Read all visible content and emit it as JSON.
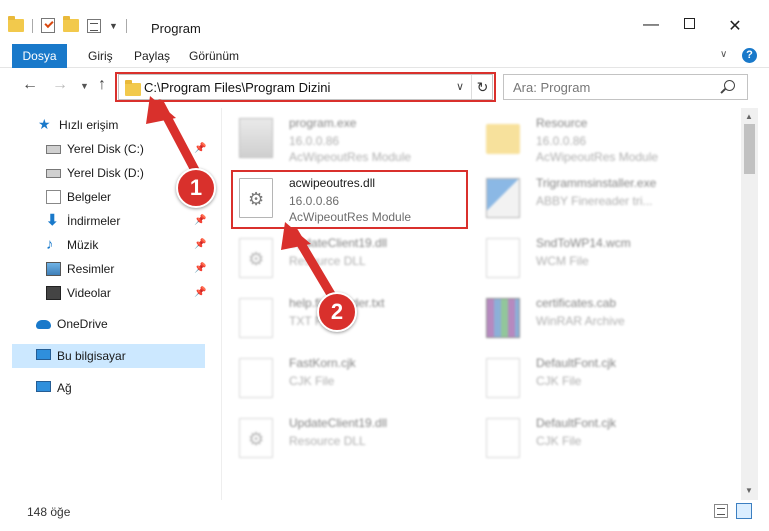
{
  "window": {
    "title": "Program"
  },
  "ribbon": {
    "tabs": [
      "Dosya",
      "Giriş",
      "Paylaş",
      "Görünüm"
    ],
    "help_icon": "help-icon"
  },
  "nav": {
    "address": "C:\\Program Files\\Program Dizini",
    "search_placeholder": "Ara: Program"
  },
  "sidebar": {
    "items": [
      {
        "label": "Hızlı erişim",
        "icon": "star-icon"
      },
      {
        "label": "Yerel Disk (C:)",
        "icon": "disk-icon",
        "pinned": true
      },
      {
        "label": "Yerel Disk (D:)",
        "icon": "disk-icon"
      },
      {
        "label": "Belgeler",
        "icon": "documents-icon",
        "pinned": true
      },
      {
        "label": "İndirmeler",
        "icon": "download-icon",
        "pinned": true
      },
      {
        "label": "Müzik",
        "icon": "music-icon",
        "pinned": true
      },
      {
        "label": "Resimler",
        "icon": "pictures-icon",
        "pinned": true
      },
      {
        "label": "Videolar",
        "icon": "videos-icon",
        "pinned": true
      },
      {
        "label": "OneDrive",
        "icon": "cloud-icon"
      },
      {
        "label": "Bu bilgisayar",
        "icon": "pc-icon",
        "selected": true
      },
      {
        "label": "Ağ",
        "icon": "network-icon"
      }
    ]
  },
  "files": [
    {
      "name": "program.exe",
      "line2": "16.0.0.86",
      "line3": "AcWipeoutRes Module",
      "icon": "exe-icon"
    },
    {
      "name": "Resource",
      "line2": "16.0.0.86",
      "line3": "AcWipeoutRes Module",
      "icon": "folder-icon"
    },
    {
      "name": "acwipeoutres.dll",
      "line2": "16.0.0.86",
      "line3": "AcWipeoutRes Module",
      "icon": "dll-icon",
      "highlighted": true
    },
    {
      "name": "Trigrammsinstaller.exe",
      "line2": "ABBY Finereader tri...",
      "line3": "",
      "icon": "installer-icon"
    },
    {
      "name": "UpdateClient19.dll",
      "line2": "Resource DLL",
      "line3": "",
      "icon": "dll-icon"
    },
    {
      "name": "SndToWP14.wcm",
      "line2": "WCM File",
      "line3": "",
      "icon": "file-icon"
    },
    {
      "name": "help.finereader.txt",
      "line2": "TXT File",
      "line3": "",
      "icon": "file-icon"
    },
    {
      "name": "certificates.cab",
      "line2": "WinRAR Archive",
      "line3": "",
      "icon": "winrar-icon"
    },
    {
      "name": "FastKorn.cjk",
      "line2": "CJK File",
      "line3": "",
      "icon": "file-icon"
    },
    {
      "name": "DefaultFont.cjk",
      "line2": "CJK File",
      "line3": "",
      "icon": "file-icon"
    },
    {
      "name": "UpdateClient19.dll",
      "line2": "Resource DLL",
      "line3": "",
      "icon": "dll-icon"
    },
    {
      "name": "DefaultFont.cjk",
      "line2": "CJK File",
      "line3": "",
      "icon": "file-icon"
    }
  ],
  "status": {
    "count": "148 öğe"
  },
  "annotations": {
    "step1": "1",
    "step2": "2",
    "color": "#d9302c"
  },
  "colors": {
    "accent": "#1979ca",
    "selected_bg": "#cce8ff"
  }
}
